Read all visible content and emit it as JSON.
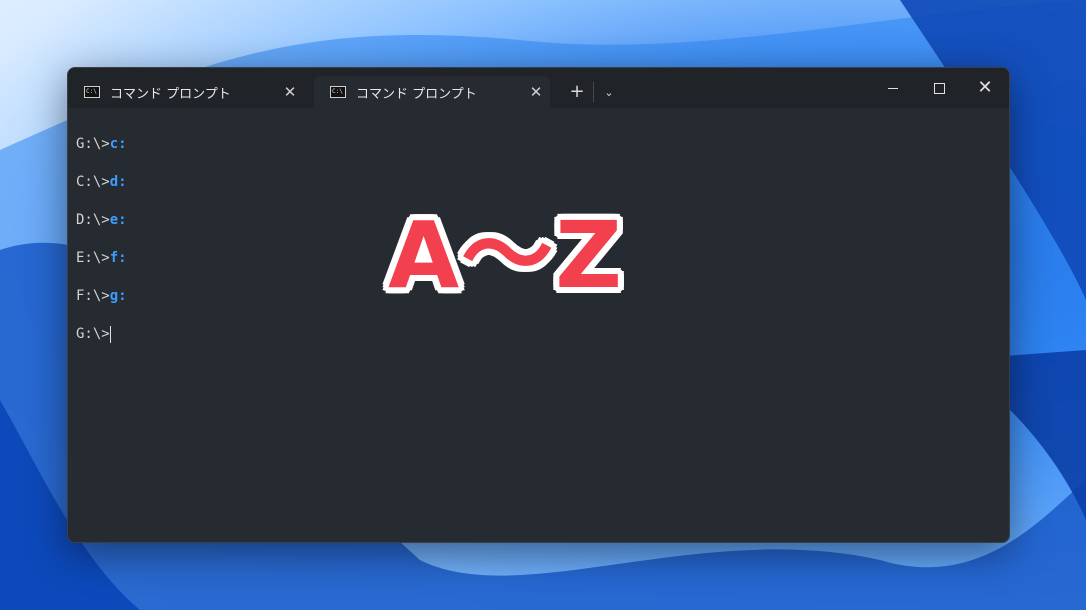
{
  "tabs": [
    {
      "label": "コマンド プロンプト",
      "icon": "cmd-icon",
      "close": "✕"
    },
    {
      "label": "コマンド プロンプト",
      "icon": "cmd-icon",
      "close": "✕"
    }
  ],
  "tab_icon_text": "C:\\",
  "new_tab": "+",
  "dropdown": "⌄",
  "window_controls": {
    "close": "✕"
  },
  "terminal": {
    "lines": [
      {
        "prompt": "G:\\>",
        "command": "c:"
      },
      {
        "prompt": "C:\\>",
        "command": "d:"
      },
      {
        "prompt": "D:\\>",
        "command": "e:"
      },
      {
        "prompt": "E:\\>",
        "command": "f:"
      },
      {
        "prompt": "F:\\>",
        "command": "g:"
      },
      {
        "prompt": "G:\\>",
        "command": ""
      }
    ]
  },
  "overlay": {
    "text": "A〜Z",
    "color": "#f2404f"
  },
  "colors": {
    "command": "#3b9dff",
    "background": "#262a31",
    "titlebar": "#202328"
  }
}
